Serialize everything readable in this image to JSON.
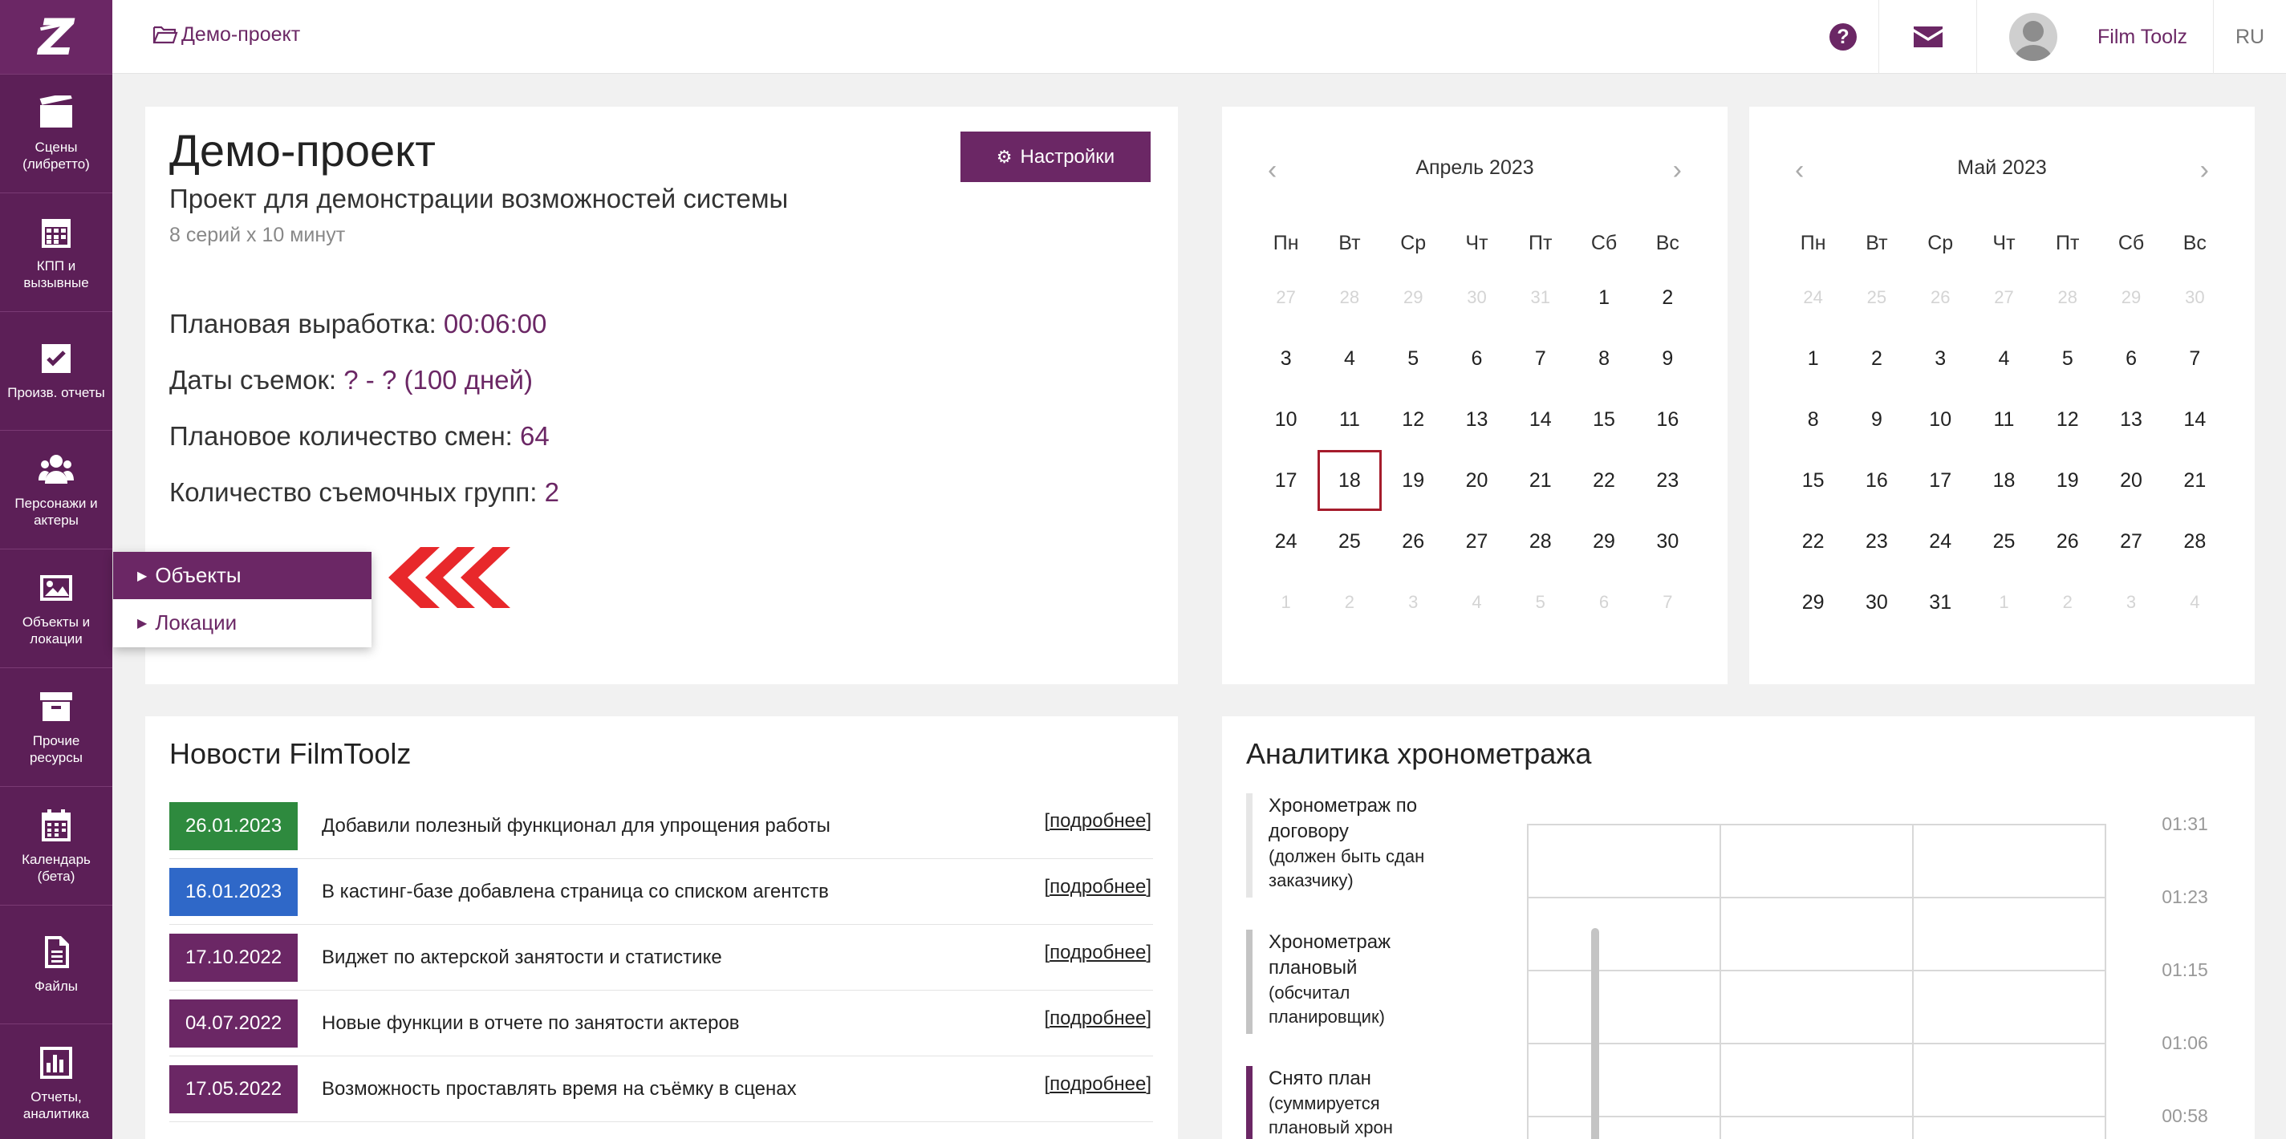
{
  "colors": {
    "brand": "#6b2765",
    "sidebar": "#5c1f57",
    "news_green": "#2e8a3e",
    "news_blue": "#2f68c8",
    "today_border": "#a51c2c"
  },
  "sidebar": {
    "items": [
      {
        "label": "Сцены\n(либретто)",
        "icon": "clapperboard-icon"
      },
      {
        "label": "КПП и\nвызывные",
        "icon": "calendar-grid-icon"
      },
      {
        "label": "Произв. отчеты",
        "icon": "checkbox-icon"
      },
      {
        "label": "Персонажи и\nактеры",
        "icon": "users-icon"
      },
      {
        "label": "Объекты и\nлокации",
        "icon": "image-icon"
      },
      {
        "label": "Прочие\nресурсы",
        "icon": "archive-icon"
      },
      {
        "label": "Календарь\n(бета)",
        "icon": "calendar-icon"
      },
      {
        "label": "Файлы",
        "icon": "file-icon"
      },
      {
        "label": "Отчеты,\nаналитика",
        "icon": "bar-chart-icon"
      }
    ]
  },
  "topbar": {
    "breadcrumb": "Демо-проект",
    "user_name": "Film Toolz",
    "lang": "RU",
    "help": "?"
  },
  "project": {
    "title": "Демо-проект",
    "subtitle": "Проект для демонстрации возможностей системы",
    "meta": "8 серий х 10 минут",
    "settings_label": "Настройки",
    "stats": [
      {
        "label": "Плановая выработка: ",
        "value": "00:06:00"
      },
      {
        "label": "Даты съемок: ",
        "value": "? - ? (100 дней)"
      },
      {
        "label": "Плановое количество смен: ",
        "value": "64"
      },
      {
        "label": "Количество съемочных групп: ",
        "value": "2"
      }
    ]
  },
  "objects_menu": {
    "items": [
      "Объекты",
      "Локации"
    ]
  },
  "calendars": [
    {
      "title": "Апрель 2023",
      "dow": [
        "Пн",
        "Вт",
        "Ср",
        "Чт",
        "Пт",
        "Сб",
        "Вс"
      ],
      "today": "18",
      "weeks": [
        [
          "27",
          "28",
          "29",
          "30",
          "31",
          "1",
          "2"
        ],
        [
          "3",
          "4",
          "5",
          "6",
          "7",
          "8",
          "9"
        ],
        [
          "10",
          "11",
          "12",
          "13",
          "14",
          "15",
          "16"
        ],
        [
          "17",
          "18",
          "19",
          "20",
          "21",
          "22",
          "23"
        ],
        [
          "24",
          "25",
          "26",
          "27",
          "28",
          "29",
          "30"
        ],
        [
          "1",
          "2",
          "3",
          "4",
          "5",
          "6",
          "7"
        ]
      ],
      "muted_first": 5,
      "muted_last_row": true
    },
    {
      "title": "Май 2023",
      "dow": [
        "Пн",
        "Вт",
        "Ср",
        "Чт",
        "Пт",
        "Сб",
        "Вс"
      ],
      "today": "",
      "weeks": [
        [
          "24",
          "25",
          "26",
          "27",
          "28",
          "29",
          "30"
        ],
        [
          "1",
          "2",
          "3",
          "4",
          "5",
          "6",
          "7"
        ],
        [
          "8",
          "9",
          "10",
          "11",
          "12",
          "13",
          "14"
        ],
        [
          "15",
          "16",
          "17",
          "18",
          "19",
          "20",
          "21"
        ],
        [
          "22",
          "23",
          "24",
          "25",
          "26",
          "27",
          "28"
        ],
        [
          "29",
          "30",
          "31",
          "1",
          "2",
          "3",
          "4"
        ]
      ]
    }
  ],
  "news": {
    "title": "Новости FilmToolz",
    "more_label": "подробнее",
    "items": [
      {
        "date": "26.01.2023",
        "text": "Добавили полезный функционал для упрощения работы",
        "color": "#2e8a3e"
      },
      {
        "date": "16.01.2023",
        "text": "В кастинг-базе добавлена страница со списком агентств",
        "color": "#2f68c8"
      },
      {
        "date": "17.10.2022",
        "text": "Виджет по актерской занятости и статистике",
        "color": "#6b2765"
      },
      {
        "date": "04.07.2022",
        "text": "Новые функции в отчете по занятости актеров",
        "color": "#6b2765"
      },
      {
        "date": "17.05.2022",
        "text": "Возможность проставлять время на съёмку в сценах",
        "color": "#6b2765"
      }
    ]
  },
  "analytics": {
    "title": "Аналитика хронометража",
    "legend": [
      {
        "title": "Хронометраж по договору",
        "sub": "(должен быть сдан заказчику)",
        "color": "#e6e6e6"
      },
      {
        "title": "Хронометраж плановый",
        "sub": "(обсчитал планировщик)",
        "color": "#c4c4c4"
      },
      {
        "title": "Снято план",
        "sub": "(суммируется плановый хрон",
        "color": "#6b2765"
      }
    ],
    "chart_data": {
      "type": "bar",
      "y_tick_labels": [
        "01:31",
        "01:23",
        "01:15",
        "01:06",
        "00:58"
      ],
      "grid": true
    }
  }
}
